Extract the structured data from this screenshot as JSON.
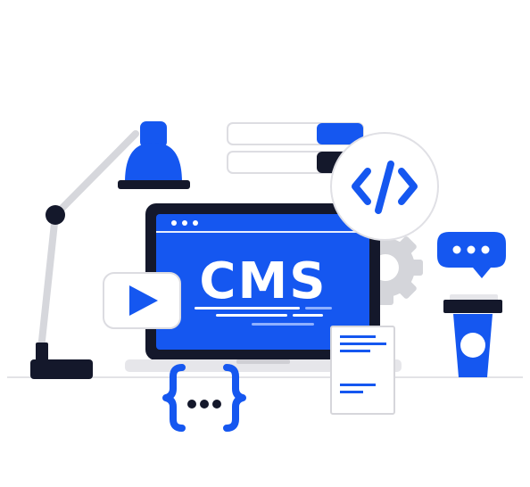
{
  "illustration": {
    "screen_label": "CMS",
    "colors": {
      "blue": "#1557F0",
      "dark": "#14182B",
      "light_gray": "#E6E6EA",
      "mid_gray": "#C8C9CE",
      "white": "#FFFFFF"
    },
    "icons": [
      "desk-lamp-icon",
      "laptop-icon",
      "code-brackets-icon",
      "play-video-icon",
      "gear-icon",
      "chat-bubble-icon",
      "coffee-cup-icon",
      "curly-braces-icon",
      "document-icon",
      "search-bar-icon"
    ]
  }
}
